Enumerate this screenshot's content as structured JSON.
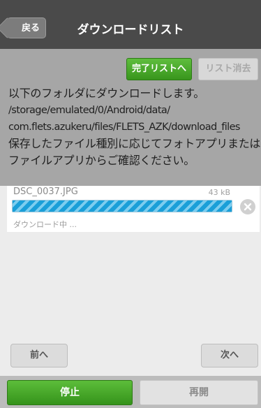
{
  "header": {
    "back_label": "戻る",
    "title": "ダウンロードリスト"
  },
  "actions": {
    "complete_list_label": "完了リストへ",
    "clear_list_label": "リスト消去"
  },
  "message": {
    "line1": "以下のフォルダにダウンロードします。",
    "path_line1": "/storage/emulated/0/Android/data/",
    "path_line2": "com.flets.azukeru/files/FLETS_AZK/download_files",
    "line2": "保存したファイル種別に応じてフォトアプリまたは",
    "line3": "ファイルアプリからご確認ください。"
  },
  "downloads": [
    {
      "file_name": "DSC_0037.JPG",
      "size": "43 kB",
      "status": "ダウンロード中 ...",
      "progress": 1.0
    }
  ],
  "pagination": {
    "prev_label": "前へ",
    "next_label": "次へ"
  },
  "footer": {
    "stop_label": "停止",
    "resume_label": "再開"
  },
  "colors": {
    "header_bg": "#4a4a4a",
    "accent_green": "#3a9a1f",
    "progress_blue": "#1a9fd8"
  }
}
